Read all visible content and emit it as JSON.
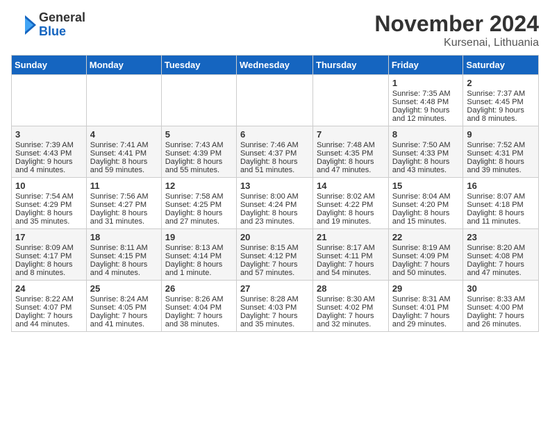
{
  "header": {
    "logo_general": "General",
    "logo_blue": "Blue",
    "month_title": "November 2024",
    "location": "Kursenai, Lithuania"
  },
  "days_of_week": [
    "Sunday",
    "Monday",
    "Tuesday",
    "Wednesday",
    "Thursday",
    "Friday",
    "Saturday"
  ],
  "weeks": [
    [
      {
        "day": "",
        "info": ""
      },
      {
        "day": "",
        "info": ""
      },
      {
        "day": "",
        "info": ""
      },
      {
        "day": "",
        "info": ""
      },
      {
        "day": "",
        "info": ""
      },
      {
        "day": "1",
        "info": "Sunrise: 7:35 AM\nSunset: 4:48 PM\nDaylight: 9 hours and 12 minutes."
      },
      {
        "day": "2",
        "info": "Sunrise: 7:37 AM\nSunset: 4:45 PM\nDaylight: 9 hours and 8 minutes."
      }
    ],
    [
      {
        "day": "3",
        "info": "Sunrise: 7:39 AM\nSunset: 4:43 PM\nDaylight: 9 hours and 4 minutes."
      },
      {
        "day": "4",
        "info": "Sunrise: 7:41 AM\nSunset: 4:41 PM\nDaylight: 8 hours and 59 minutes."
      },
      {
        "day": "5",
        "info": "Sunrise: 7:43 AM\nSunset: 4:39 PM\nDaylight: 8 hours and 55 minutes."
      },
      {
        "day": "6",
        "info": "Sunrise: 7:46 AM\nSunset: 4:37 PM\nDaylight: 8 hours and 51 minutes."
      },
      {
        "day": "7",
        "info": "Sunrise: 7:48 AM\nSunset: 4:35 PM\nDaylight: 8 hours and 47 minutes."
      },
      {
        "day": "8",
        "info": "Sunrise: 7:50 AM\nSunset: 4:33 PM\nDaylight: 8 hours and 43 minutes."
      },
      {
        "day": "9",
        "info": "Sunrise: 7:52 AM\nSunset: 4:31 PM\nDaylight: 8 hours and 39 minutes."
      }
    ],
    [
      {
        "day": "10",
        "info": "Sunrise: 7:54 AM\nSunset: 4:29 PM\nDaylight: 8 hours and 35 minutes."
      },
      {
        "day": "11",
        "info": "Sunrise: 7:56 AM\nSunset: 4:27 PM\nDaylight: 8 hours and 31 minutes."
      },
      {
        "day": "12",
        "info": "Sunrise: 7:58 AM\nSunset: 4:25 PM\nDaylight: 8 hours and 27 minutes."
      },
      {
        "day": "13",
        "info": "Sunrise: 8:00 AM\nSunset: 4:24 PM\nDaylight: 8 hours and 23 minutes."
      },
      {
        "day": "14",
        "info": "Sunrise: 8:02 AM\nSunset: 4:22 PM\nDaylight: 8 hours and 19 minutes."
      },
      {
        "day": "15",
        "info": "Sunrise: 8:04 AM\nSunset: 4:20 PM\nDaylight: 8 hours and 15 minutes."
      },
      {
        "day": "16",
        "info": "Sunrise: 8:07 AM\nSunset: 4:18 PM\nDaylight: 8 hours and 11 minutes."
      }
    ],
    [
      {
        "day": "17",
        "info": "Sunrise: 8:09 AM\nSunset: 4:17 PM\nDaylight: 8 hours and 8 minutes."
      },
      {
        "day": "18",
        "info": "Sunrise: 8:11 AM\nSunset: 4:15 PM\nDaylight: 8 hours and 4 minutes."
      },
      {
        "day": "19",
        "info": "Sunrise: 8:13 AM\nSunset: 4:14 PM\nDaylight: 8 hours and 1 minute."
      },
      {
        "day": "20",
        "info": "Sunrise: 8:15 AM\nSunset: 4:12 PM\nDaylight: 7 hours and 57 minutes."
      },
      {
        "day": "21",
        "info": "Sunrise: 8:17 AM\nSunset: 4:11 PM\nDaylight: 7 hours and 54 minutes."
      },
      {
        "day": "22",
        "info": "Sunrise: 8:19 AM\nSunset: 4:09 PM\nDaylight: 7 hours and 50 minutes."
      },
      {
        "day": "23",
        "info": "Sunrise: 8:20 AM\nSunset: 4:08 PM\nDaylight: 7 hours and 47 minutes."
      }
    ],
    [
      {
        "day": "24",
        "info": "Sunrise: 8:22 AM\nSunset: 4:07 PM\nDaylight: 7 hours and 44 minutes."
      },
      {
        "day": "25",
        "info": "Sunrise: 8:24 AM\nSunset: 4:05 PM\nDaylight: 7 hours and 41 minutes."
      },
      {
        "day": "26",
        "info": "Sunrise: 8:26 AM\nSunset: 4:04 PM\nDaylight: 7 hours and 38 minutes."
      },
      {
        "day": "27",
        "info": "Sunrise: 8:28 AM\nSunset: 4:03 PM\nDaylight: 7 hours and 35 minutes."
      },
      {
        "day": "28",
        "info": "Sunrise: 8:30 AM\nSunset: 4:02 PM\nDaylight: 7 hours and 32 minutes."
      },
      {
        "day": "29",
        "info": "Sunrise: 8:31 AM\nSunset: 4:01 PM\nDaylight: 7 hours and 29 minutes."
      },
      {
        "day": "30",
        "info": "Sunrise: 8:33 AM\nSunset: 4:00 PM\nDaylight: 7 hours and 26 minutes."
      }
    ]
  ]
}
